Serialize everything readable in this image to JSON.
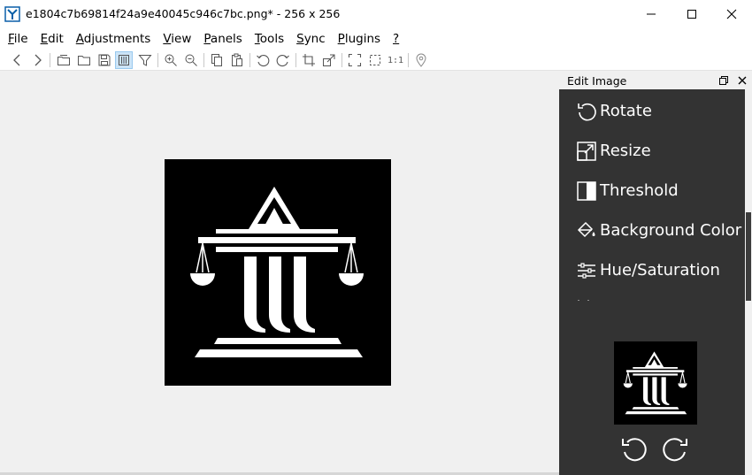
{
  "window": {
    "title": "e1804c7b69814f24a9e40045c946c7bc.png*  - 256 x 256",
    "minimize_icon": "minimize-icon",
    "maximize_icon": "maximize-icon",
    "close_icon": "close-icon"
  },
  "menu": [
    {
      "acc": "F",
      "rest": "ile"
    },
    {
      "acc": "E",
      "rest": "dit"
    },
    {
      "acc": "A",
      "rest": "djustments"
    },
    {
      "acc": "V",
      "rest": "iew"
    },
    {
      "acc": "P",
      "rest": "anels"
    },
    {
      "acc": "T",
      "rest": "ools"
    },
    {
      "acc": "S",
      "rest": "ync"
    },
    {
      "acc": "P",
      "rest": "lugins"
    },
    {
      "acc": "?",
      "rest": ""
    }
  ],
  "toolbar": {
    "icons": [
      "back-icon",
      "forward-icon",
      "open-folder-icon",
      "folder-icon",
      "save-icon",
      "thumbnail-bar-icon",
      "filter-icon",
      "zoom-in-icon",
      "zoom-out-icon",
      "copy-icon",
      "paste-icon",
      "rotate-left-icon",
      "rotate-right-icon",
      "crop-icon",
      "resize-icon",
      "fullscreen-icon",
      "select-icon",
      "actual-size-icon",
      "location-pin-icon"
    ],
    "actual_size_label": "1:1"
  },
  "panel": {
    "title": "Edit Image",
    "items": [
      {
        "label": "Rotate",
        "icon": "rotate-icon"
      },
      {
        "label": "Resize",
        "icon": "resize-icon"
      },
      {
        "label": "Threshold",
        "icon": "threshold-icon"
      },
      {
        "label": "Background Color",
        "icon": "paint-bucket-icon"
      },
      {
        "label": "Hue/Saturation",
        "icon": "sliders-icon"
      }
    ]
  },
  "colors": {
    "panel_bg": "#333333",
    "canvas_bg": "#f0f0f0",
    "accent": "#cce4f7"
  }
}
